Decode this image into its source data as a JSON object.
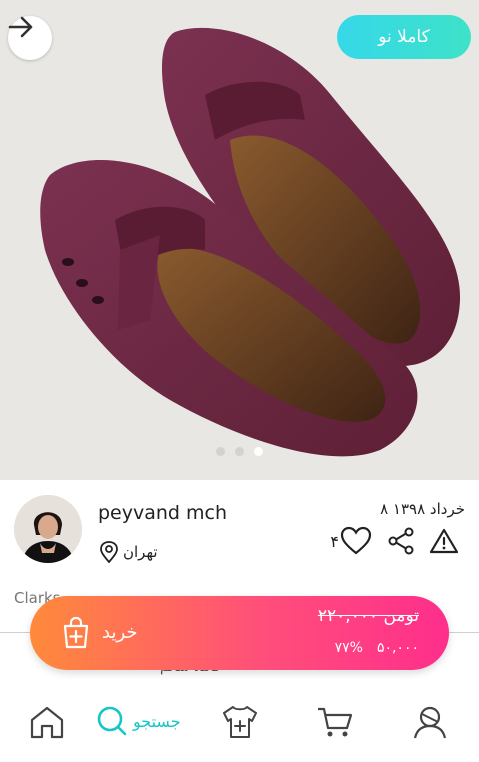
{
  "listing": {
    "condition_badge": "کاملا نو",
    "images": {
      "count": 3,
      "active_index": 0
    }
  },
  "seller": {
    "name": "peyvand mch",
    "location": "تهران"
  },
  "post": {
    "date": "۸ خرداد ۱۳۹۸",
    "likes": "۴",
    "description_preview": "Clarks",
    "description_line2": "کاملا سالم"
  },
  "buy": {
    "button_label": "خرید",
    "price": "۲۲۰,۰۰۰ تومن",
    "discount": "۷۷%",
    "original_price": "۵۰,۰۰۰"
  },
  "nav": {
    "search_label": "جستجو",
    "items": [
      "home-icon",
      "search-icon",
      "add-post-icon",
      "cart-icon",
      "profile-icon"
    ]
  },
  "colors": {
    "badge_gradient": [
      "#35d8e8",
      "#3ee2c8"
    ],
    "buy_gradient": [
      "#ff8a3a",
      "#ff4f7a",
      "#ff2e8c"
    ],
    "accent": "#16c6c6",
    "shoe": "#6e2740"
  }
}
